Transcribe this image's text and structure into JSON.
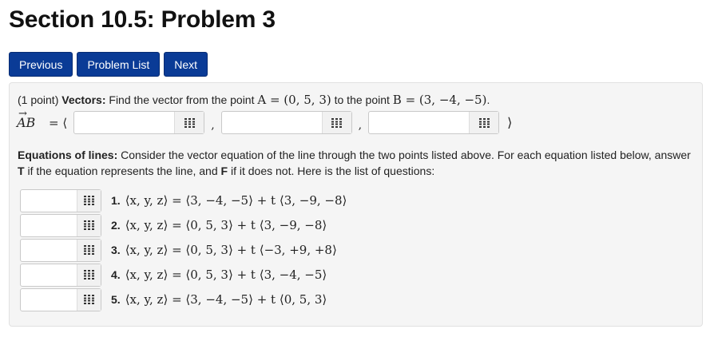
{
  "page": {
    "title": "Section 10.5: Problem 3"
  },
  "nav": {
    "previous": "Previous",
    "problem_list": "Problem List",
    "next": "Next"
  },
  "problem": {
    "points": "(1 point)",
    "vectors_label": "Vectors:",
    "vectors_text": "Find the vector from the point",
    "to_text": "to the point",
    "period": ".",
    "point_a": "A = (0, 5, 3)",
    "point_b": "B = (3, −4, −5)",
    "vector_name": "AB",
    "vector_arrow": "→",
    "eq_open": "= ⟨",
    "comma": ",",
    "angle_close": "⟩",
    "vector_inputs": [
      "",
      "",
      ""
    ],
    "equations_label": "Equations of lines:",
    "equations_text": "Consider the vector equation of the line through the two points listed above. For each equation listed below, answer",
    "t_bold": "T",
    "t_text": "if the equation represents the line, and",
    "f_bold": "F",
    "f_text": "if it does not. Here is the list of questions:",
    "questions": [
      {
        "num": "1.",
        "eq": "⟨x, y, z⟩ = ⟨3, −4, −5⟩ + t ⟨3, −9, −8⟩",
        "value": ""
      },
      {
        "num": "2.",
        "eq": "⟨x, y, z⟩ = ⟨0, 5, 3⟩ + t ⟨3, −9, −8⟩",
        "value": ""
      },
      {
        "num": "3.",
        "eq": "⟨x, y, z⟩ = ⟨0, 5, 3⟩ + t ⟨−3, +9, +8⟩",
        "value": ""
      },
      {
        "num": "4.",
        "eq": "⟨x, y, z⟩ = ⟨0, 5, 3⟩ + t ⟨3, −4, −5⟩",
        "value": ""
      },
      {
        "num": "5.",
        "eq": "⟨x, y, z⟩ = ⟨3, −4, −5⟩ + t ⟨0, 5, 3⟩",
        "value": ""
      }
    ]
  },
  "icons": {
    "answer_helper": "grid-icon"
  },
  "colors": {
    "nav_button": "#0a3b96",
    "panel_bg": "#f5f5f5"
  }
}
